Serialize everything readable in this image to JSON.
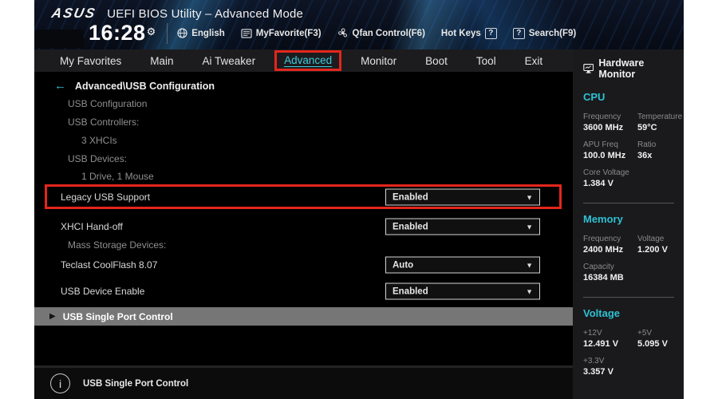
{
  "header": {
    "brand": "ASUS",
    "title": "UEFI BIOS Utility – Advanced Mode",
    "time": "16:28",
    "gear_icon": "⚙",
    "language": "English",
    "my_favorite": "MyFavorite(F3)",
    "qfan": "Qfan Control(F6)",
    "hot_keys": "Hot Keys",
    "hot_keys_badge": "?",
    "search_badge": "?",
    "search": "Search(F9)"
  },
  "menu": {
    "tabs": [
      "My Favorites",
      "Main",
      "Ai Tweaker",
      "Advanced",
      "Monitor",
      "Boot",
      "Tool",
      "Exit"
    ],
    "active_tab": "Advanced"
  },
  "content": {
    "back_arrow": "←",
    "breadcrumb": "Advanced\\USB Configuration",
    "section_title": "USB Configuration",
    "usb_controllers_label": "USB Controllers:",
    "usb_controllers_value": "3 XHCIs",
    "usb_devices_label": "USB Devices:",
    "usb_devices_value": "1 Drive, 1 Mouse",
    "legacy_usb": {
      "label": "Legacy USB Support",
      "value": "Enabled"
    },
    "xhci": {
      "label": "XHCI Hand-off",
      "value": "Enabled"
    },
    "mass_storage_label": "Mass Storage Devices:",
    "teclast": {
      "label": "Teclast CoolFlash 8.07",
      "value": "Auto"
    },
    "usb_device_enable": {
      "label": "USB Device Enable",
      "value": "Enabled"
    },
    "single_port": {
      "arrow": "▶",
      "label": "USB Single Port Control"
    },
    "dropdown_caret": "▼"
  },
  "sidebar": {
    "title": "Hardware Monitor",
    "cpu": {
      "title": "CPU",
      "frequency_label": "Frequency",
      "frequency": "3600 MHz",
      "temperature_label": "Temperature",
      "temperature": "59°C",
      "apu_label": "APU Freq",
      "apu": "100.0 MHz",
      "ratio_label": "Ratio",
      "ratio": "36x",
      "core_voltage_label": "Core Voltage",
      "core_voltage": "1.384 V"
    },
    "memory": {
      "title": "Memory",
      "frequency_label": "Frequency",
      "frequency": "2400 MHz",
      "voltage_label": "Voltage",
      "voltage": "1.200 V",
      "capacity_label": "Capacity",
      "capacity": "16384 MB"
    },
    "voltage": {
      "title": "Voltage",
      "v12_label": "+12V",
      "v12": "12.491 V",
      "v5_label": "+5V",
      "v5": "5.095 V",
      "v33_label": "+3.3V",
      "v33": "3.357 V"
    }
  },
  "footer": {
    "info_icon": "i",
    "hint": "USB Single Port Control"
  },
  "colors": {
    "accent_cyan": "#2fc0d4",
    "highlight_red": "#e3261c",
    "selected_row_gray": "#767676"
  }
}
